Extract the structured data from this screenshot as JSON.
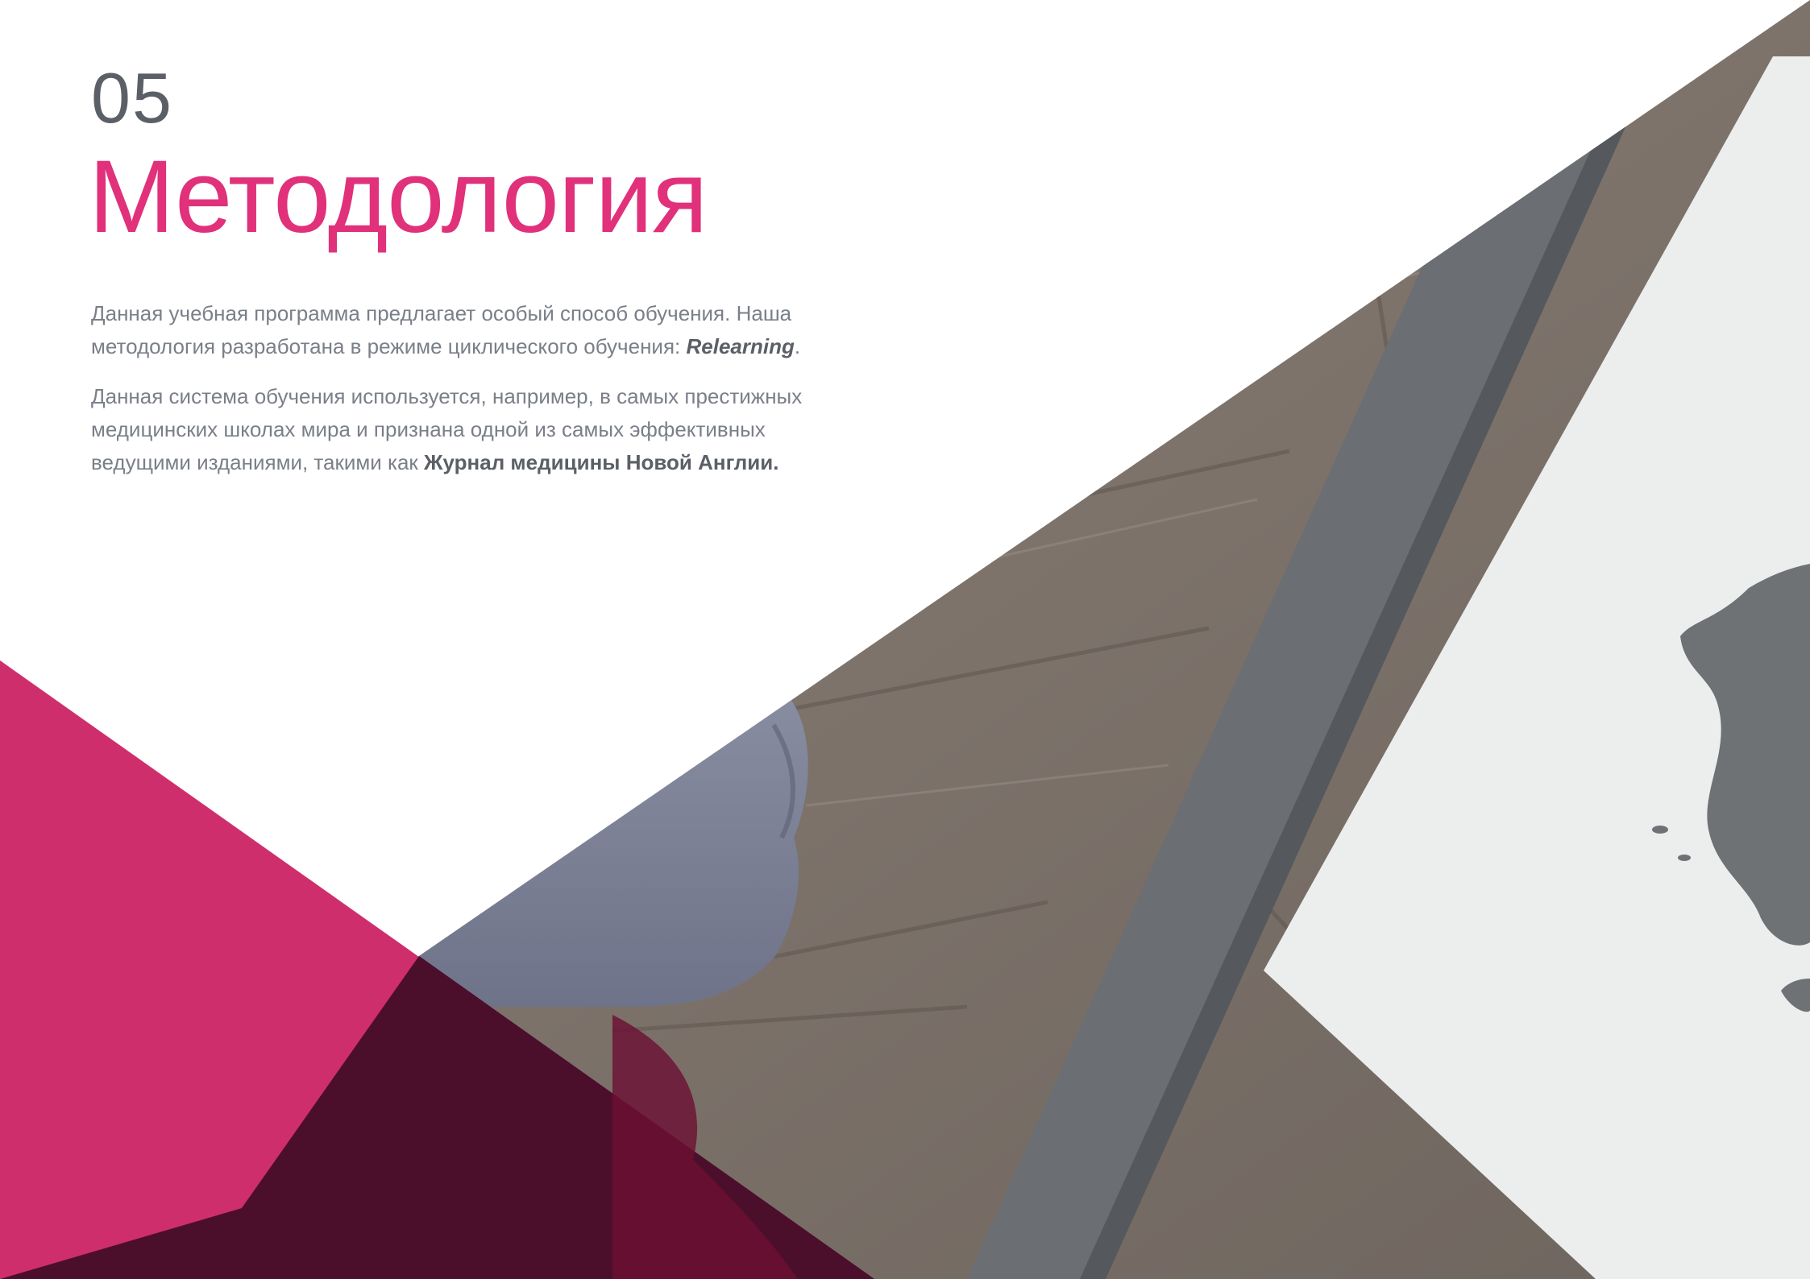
{
  "section": {
    "number": "05",
    "title": "Методология"
  },
  "intro": {
    "para1_text": "Данная учебная программа предлагает особый способ обучения. Наша методология разработана в режиме циклического обучения: ",
    "para1_emphasis": "Relearning",
    "para1_end": ".",
    "para2_text": "Данная система обучения используется, например, в самых престижных медицинских школах мира и признана одной из самых эффективных ведущими изданиями, такими как ",
    "para2_strong": "Журнал медицины Новой Англии."
  },
  "colors": {
    "accent": "#e0317a",
    "accent_dark_overlay": "#4a0f2b",
    "pink_triangle": "#cf2e6c",
    "text_gray": "#7a7f88",
    "number_gray": "#5b5f66"
  },
  "images": {
    "background_photo": "wooden-table-with-paper-map-and-person"
  }
}
